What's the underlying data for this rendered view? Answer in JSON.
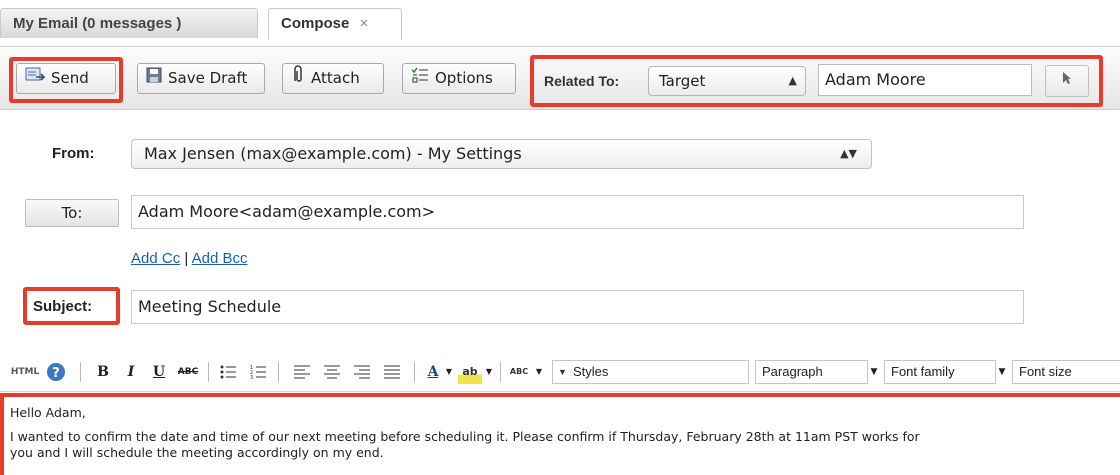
{
  "tabs": [
    {
      "label": "My Email (0 messages )"
    },
    {
      "label": "Compose",
      "close": "×"
    }
  ],
  "toolbar": {
    "send": "Send",
    "save_draft": "Save Draft",
    "attach": "Attach",
    "options": "Options",
    "related_to_label": "Related To:",
    "related_type": "Target",
    "related_name": "Adam Moore"
  },
  "form": {
    "from_label": "From:",
    "from_value": "Max Jensen (max@example.com) - My Settings",
    "to_label": "To:",
    "to_value": "Adam Moore<adam@example.com>",
    "add_cc": "Add Cc",
    "separator": "|",
    "add_bcc": "Add Bcc",
    "subject_label": "Subject:",
    "subject_value": "Meeting Schedule"
  },
  "editor": {
    "html_label": "HTML",
    "bold": "B",
    "italic": "I",
    "underline": "U",
    "strike": "ABC",
    "styles": "Styles",
    "paragraph": "Paragraph",
    "font_family": "Font family",
    "font_size": "Font size",
    "text_color_glyph": "A",
    "highlight_glyph": "ab",
    "spell_glyph": "ABC"
  },
  "body": {
    "greeting": "Hello Adam,",
    "line1": "I wanted to confirm the date and time of our next meeting before scheduling it. Please confirm if Thursday, February 28th at 11am PST works for",
    "line2": "you and I will schedule the meeting accordingly on my end."
  },
  "colors": {
    "highlight": "#e53c2b",
    "link": "#1a5fb4"
  },
  "icons": [
    "send-icon",
    "save-icon",
    "attach-icon",
    "options-icon",
    "arrow-cursor-icon",
    "help-icon"
  ]
}
